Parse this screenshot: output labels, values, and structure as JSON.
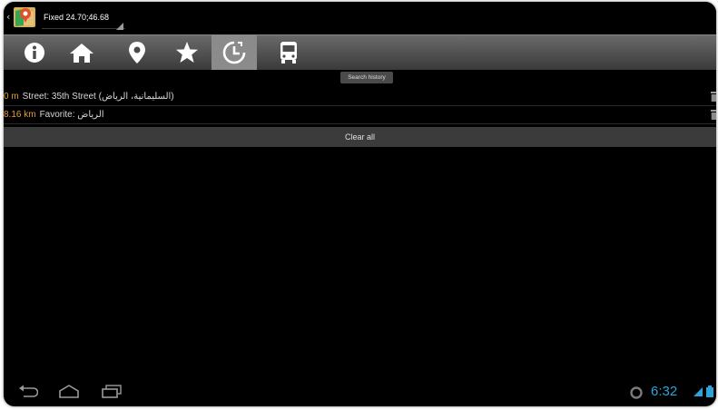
{
  "titlebar": {
    "title": "Fixed 24.70;46.68",
    "app_icon": "map-app-icon"
  },
  "toolbar": {
    "buttons": [
      {
        "icon": "info-icon"
      },
      {
        "icon": "home-icon"
      },
      {
        "icon": "location-pin-icon"
      },
      {
        "icon": "star-icon"
      },
      {
        "icon": "history-clock-icon",
        "active": true
      },
      {
        "icon": "bus-icon"
      }
    ],
    "tooltip": "Search history"
  },
  "history": {
    "items": [
      {
        "distance": "0 m",
        "label": "Street: 35th Street (السليمانية، الرياض)",
        "icon": "trash-icon"
      },
      {
        "distance": "8.16 km",
        "label": "Favorite: الرياض",
        "icon": "trash-icon"
      }
    ],
    "clear_all": "Clear all"
  },
  "statusbar": {
    "clock": "6:32",
    "nav_icons": [
      "back-icon",
      "home-nav-icon",
      "recent-apps-icon"
    ]
  },
  "colors": {
    "background": "#000000",
    "distance": "#e89b34",
    "clock": "#2fa3d8",
    "active_tab": "#8b8b8b"
  }
}
